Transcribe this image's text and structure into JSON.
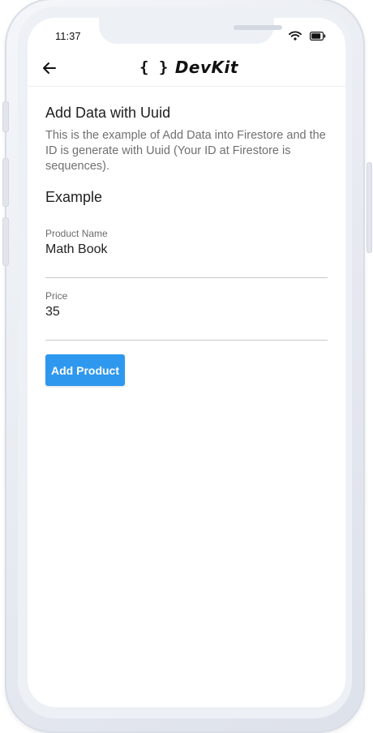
{
  "status_bar": {
    "time": "11:37",
    "wifi_icon": "wifi-icon",
    "battery_icon": "battery-icon"
  },
  "app_bar": {
    "back_icon": "arrow-left-icon",
    "logo_braces": "{ }",
    "logo_name": "DevKit"
  },
  "content": {
    "title": "Add Data with Uuid",
    "description": "This is the example of Add Data into Firestore and the ID is generate with Uuid (Your ID at Firestore is sequences).",
    "example_heading": "Example",
    "fields": [
      {
        "label": "Product Name",
        "value": "Math Book"
      },
      {
        "label": "Price",
        "value": "35"
      }
    ],
    "add_button_label": "Add Product"
  },
  "colors": {
    "accent": "#2e98ef",
    "text": "#202020",
    "muted": "#707070"
  }
}
